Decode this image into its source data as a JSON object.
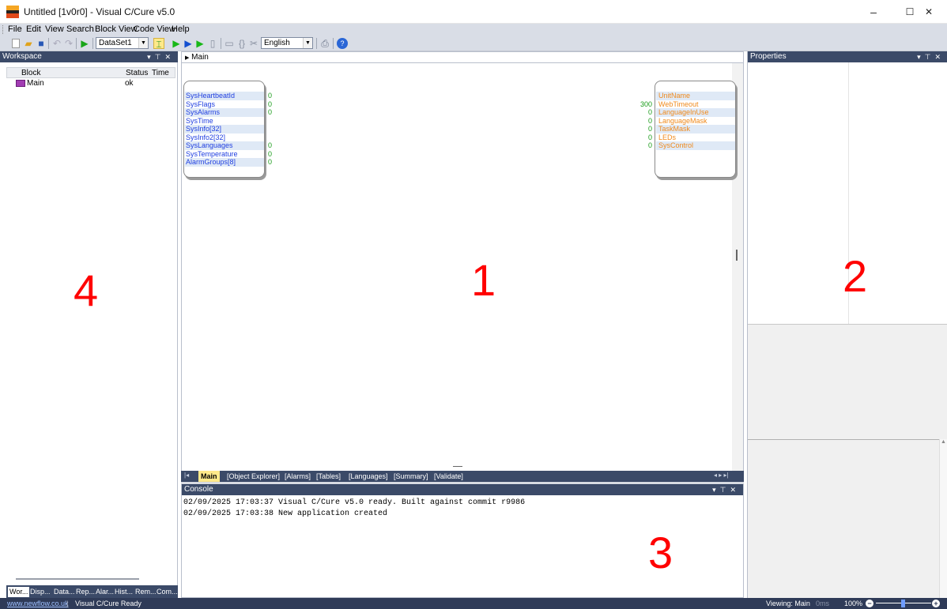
{
  "window": {
    "title": "Untitled [1v0r0] - Visual C/Cure v5.0",
    "min": "–",
    "max": "☐",
    "close": "✕"
  },
  "menu": [
    "File",
    "Edit",
    "View",
    "Search",
    "Block View",
    "Code View",
    "Help"
  ],
  "toolbar": {
    "dataset": "DataSet1",
    "language": "English"
  },
  "workspace": {
    "title": "Workspace",
    "columns": {
      "block": "Block",
      "status": "Status",
      "time": "Time"
    },
    "rows": [
      {
        "name": "Main",
        "status": "ok",
        "time": ""
      }
    ],
    "tabs": [
      "Wor...",
      "Disp...",
      "Data...",
      "Rep...",
      "Alar...",
      "Hist...",
      "Rem...",
      "Com..."
    ]
  },
  "main": {
    "breadcrumb": "Main",
    "inputs": [
      {
        "name": "SysHeartbeatId",
        "value": "0"
      },
      {
        "name": "SysFlags",
        "value": "0"
      },
      {
        "name": "SysAlarms",
        "value": "0"
      },
      {
        "name": "SysTime",
        "value": ""
      },
      {
        "name": "SysInfo[32]",
        "value": ""
      },
      {
        "name": "SysInfo2[32]",
        "value": ""
      },
      {
        "name": "SysLanguages",
        "value": "0"
      },
      {
        "name": "SysTemperature",
        "value": "0"
      },
      {
        "name": "AlarmGroups[8]",
        "value": "0"
      }
    ],
    "outputs": [
      {
        "name": "UnitName",
        "value": ""
      },
      {
        "name": "WebTimeout",
        "value": "300"
      },
      {
        "name": "LanguageInUse",
        "value": "0"
      },
      {
        "name": "LanguageMask",
        "value": "0"
      },
      {
        "name": "TaskMask",
        "value": "0"
      },
      {
        "name": "LEDs",
        "value": "0"
      },
      {
        "name": "SysControl",
        "value": "0"
      }
    ],
    "tabs": [
      "Main",
      "[Object Explorer]",
      "[Alarms]",
      "[Tables]",
      "[Languages]",
      "[Summary]",
      "[Validate]"
    ]
  },
  "console": {
    "title": "Console",
    "lines": [
      "02/09/2025 17:03:37 Visual C/Cure v5.0 ready. Built against commit r9986",
      "02/09/2025 17:03:38 New application created"
    ]
  },
  "properties": {
    "title": "Properties"
  },
  "markers": {
    "main": "1",
    "properties": "2",
    "console": "3",
    "workspace": "4"
  },
  "status": {
    "link": "www.newflow.co.uk",
    "ready": "Visual C/Cure Ready",
    "viewing": "Viewing: Main",
    "ms": "0ms",
    "zoom": "100%"
  }
}
